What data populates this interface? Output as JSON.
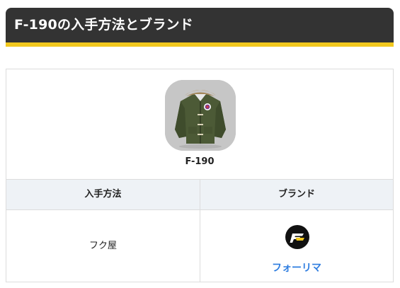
{
  "section": {
    "title": "F-190の入手方法とブランド"
  },
  "item": {
    "name": "F-190",
    "image_icon": "olive-parka-jacket-image"
  },
  "table": {
    "headers": [
      "入手方法",
      "ブランド"
    ],
    "acquisition": "フク屋",
    "brand": {
      "name": "フォーリマ",
      "logo_icon": "forge-brand-logo-icon"
    }
  },
  "colors": {
    "header_bg": "#333333",
    "header_accent": "#f2c81e",
    "table_header_bg": "#eef2f6",
    "link": "#2e7de0",
    "border": "#dcdcdc"
  }
}
